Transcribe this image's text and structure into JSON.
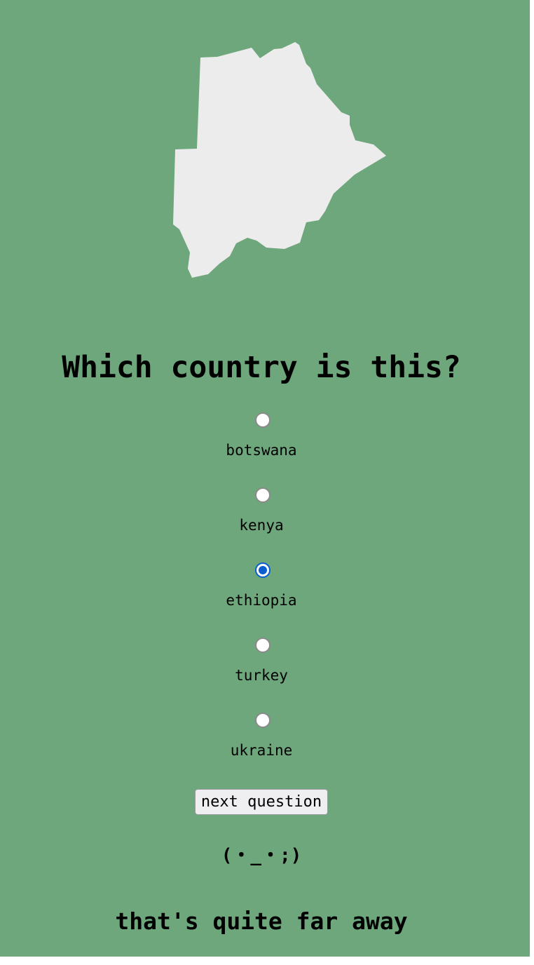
{
  "quiz": {
    "question": "Which country is this?",
    "country_shape": "country-outline",
    "shape_fill": "#ececec",
    "background": "#6da77b",
    "accent": "#0a5ecf",
    "options": [
      {
        "label": "botswana",
        "checked": false
      },
      {
        "label": "kenya",
        "checked": false
      },
      {
        "label": "ethiopia",
        "checked": true
      },
      {
        "label": "turkey",
        "checked": false
      },
      {
        "label": "ukraine",
        "checked": false
      }
    ],
    "next_label": "next question",
    "kaomoji": "(・_・;)",
    "feedback": "that's quite far away"
  }
}
